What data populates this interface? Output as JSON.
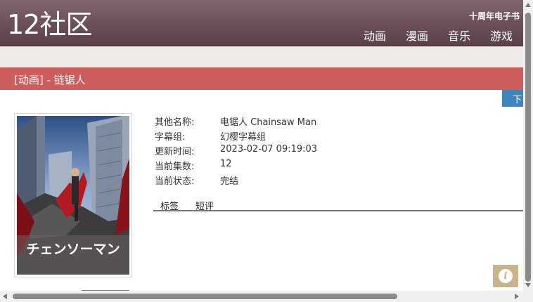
{
  "site": {
    "logo": "12社区",
    "top_link": "十周年电子书",
    "nav": [
      "动画",
      "漫画",
      "音乐",
      "游戏"
    ]
  },
  "page": {
    "title": "[动画] - 链锯人",
    "download_label": "下"
  },
  "poster": {
    "alt_text": "チェンソーマン"
  },
  "info": [
    {
      "label": "其他名称:",
      "value": "电锯人 Chainsaw Man"
    },
    {
      "label": "字幕组:",
      "value": "幻樱字幕组"
    },
    {
      "label": "更新时间:",
      "value": "2023-02-07 09:19:03"
    },
    {
      "label": "当前集数:",
      "value": "12"
    },
    {
      "label": "当前状态:",
      "value": "完结"
    }
  ],
  "tabs": [
    "标签",
    "短评"
  ],
  "info_button": {
    "icon": "info-icon",
    "glyph": "i"
  },
  "colors": {
    "header": "#6a4f57",
    "title_bar": "#cd5c5c",
    "download": "#3d86c0",
    "info_button": "#c9b38a"
  }
}
